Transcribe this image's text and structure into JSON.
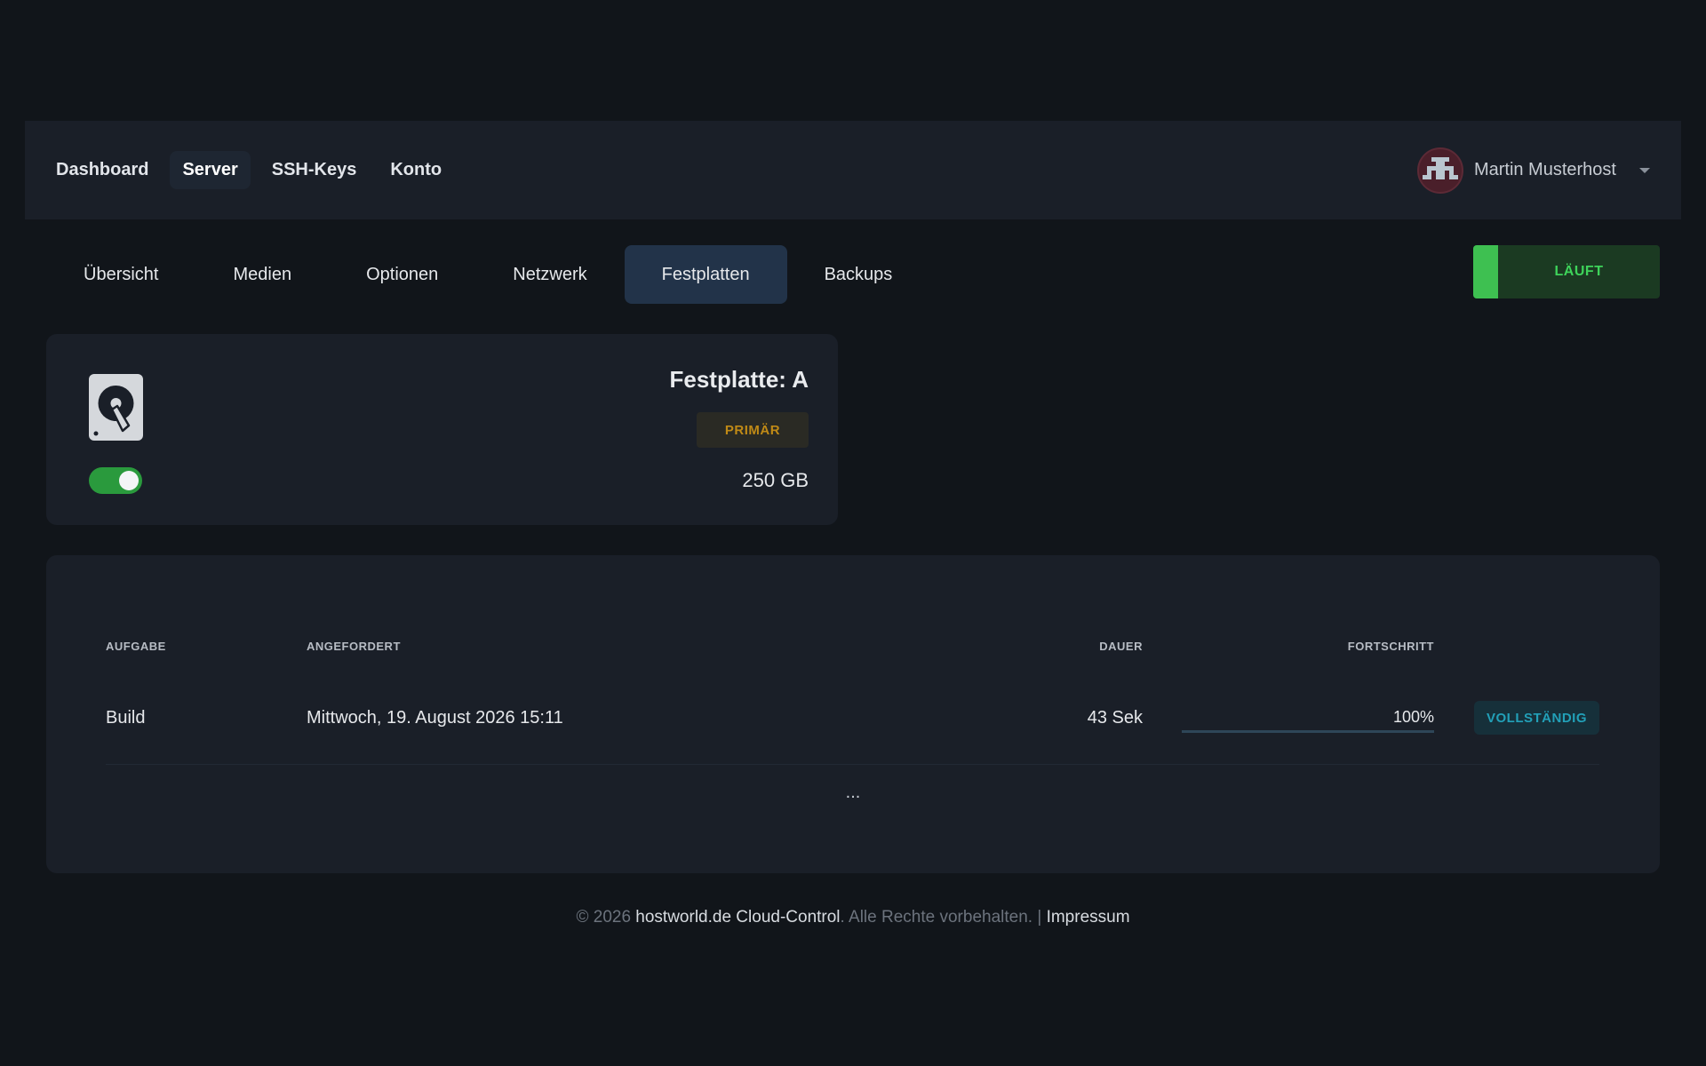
{
  "nav": {
    "links": [
      {
        "label": "Dashboard",
        "active": false
      },
      {
        "label": "Server",
        "active": true
      },
      {
        "label": "SSH-Keys",
        "active": false
      },
      {
        "label": "Konto",
        "active": false
      }
    ],
    "user": {
      "name": "Martin Musterhost",
      "avatar_icon": "pixel-avatar-icon"
    }
  },
  "tabs": [
    {
      "label": "Übersicht",
      "active": false
    },
    {
      "label": "Medien",
      "active": false
    },
    {
      "label": "Optionen",
      "active": false
    },
    {
      "label": "Netzwerk",
      "active": false
    },
    {
      "label": "Festplatten",
      "active": true
    },
    {
      "label": "Backups",
      "active": false
    }
  ],
  "status": {
    "label": "LÄUFT",
    "color": "#3ec051"
  },
  "disk": {
    "title": "Festplatte: A",
    "badge": "PRIMÄR",
    "size": "250 GB",
    "enabled": true,
    "icon": "hard-drive-icon"
  },
  "tasks": {
    "headers": {
      "task": "AUFGABE",
      "requested": "ANGEFORDERT",
      "duration": "DAUER",
      "progress": "FORTSCHRITT"
    },
    "rows": [
      {
        "task": "Build",
        "requested": "Mittwoch, 19. August 2026 15:11",
        "duration": "43 Sek",
        "progress": 100,
        "progress_label": "100%",
        "status": "VOLLSTÄNDIG"
      }
    ],
    "more": "..."
  },
  "footer": {
    "copyright": "© 2026",
    "brand": "hostworld.de Cloud-Control",
    "rights": ". Alle Rechte vorbehalten. |",
    "imprint": "Impressum"
  },
  "colors": {
    "background": "#11151a",
    "card": "#1a1f28",
    "active_tab": "#223349",
    "success": "#3ec051",
    "warning": "#c08a16",
    "info": "#22a0b8"
  }
}
